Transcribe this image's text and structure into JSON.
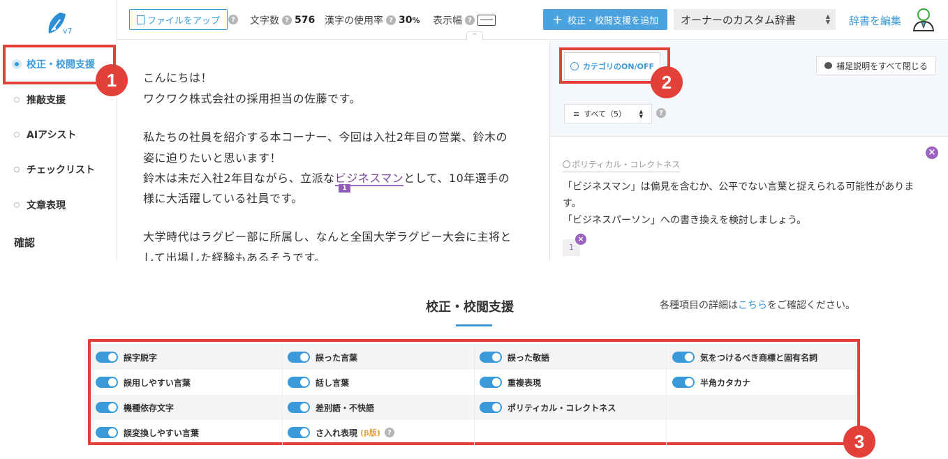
{
  "sidebar": {
    "logo_version": "v7",
    "items": [
      {
        "label": "校正・校閲支援",
        "active": true
      },
      {
        "label": "推敲支援"
      },
      {
        "label": "AIアシスト"
      },
      {
        "label": "チェックリスト"
      },
      {
        "label": "文章表現"
      }
    ],
    "section": "確認"
  },
  "toolbar": {
    "upload_label": "ファイルをアップ",
    "char_count_label": "文字数",
    "char_count_value": "576",
    "kanji_label": "漢字の使用率",
    "kanji_value": "30",
    "kanji_unit": "%",
    "width_label": "表示幅",
    "collapse_icon": "chevron-up",
    "add_label": "校正・校閲支援を追加",
    "dict_selected": "オーナーのカスタム辞書",
    "dict_edit": "辞書を編集"
  },
  "editor": {
    "lines": [
      "こんにちは！",
      "ワクワク株式会社の採用担当の佐藤です。",
      "私たちの社員を紹介する本コーナー、今回は入社2年目の営業、鈴木の",
      "姿に迫りたいと思います！",
      "鈴木は未だ入社2年目ながら、立派な",
      "ビジネスマン",
      "として、10年選手の",
      "様に大活躍している社員です。",
      "大学時代はラグビー部に所属し、なんと全国大学ラグビー大会に主将と",
      "して出場した経験もあるそうです。"
    ],
    "mark_number": "1"
  },
  "right_panel": {
    "category_toggle": "カテゴリのON/OFF",
    "close_all": "補足説明をすべて閉じる",
    "filter_label": "すべて（5）",
    "card": {
      "tag": "ポリティカル・コレクトネス",
      "body_1": "「ビジネスマン」は偏見を含むか、公平でない言葉と捉えられる可能性がありま",
      "body_2": "す。",
      "body_3": "「ビジネスパーソン」への書き換えを検討しましょう。",
      "number": "1"
    }
  },
  "annotations": [
    "1",
    "2",
    "3"
  ],
  "settings": {
    "title": "校正・校閲支援",
    "note_prefix": "各種項目の詳細は",
    "note_link": "こちら",
    "note_suffix": "をご確認ください。",
    "rows": [
      [
        "誤字脱字",
        "誤った言葉",
        "誤った敬語",
        "気をつけるべき商標と固有名詞"
      ],
      [
        "誤用しやすい言葉",
        "話し言葉",
        "重複表現",
        "半角カタカナ"
      ],
      [
        "機種依存文字",
        "差別語・不快語",
        "ポリティカル・コレクトネス",
        ""
      ],
      [
        "誤変換しやすい言葉",
        "さ入れ表現",
        "",
        ""
      ]
    ],
    "beta_label": "(β版)"
  },
  "colors": {
    "accent": "#3a9ad9",
    "highlight": "#e3403a",
    "mark": "#9b62c0"
  }
}
